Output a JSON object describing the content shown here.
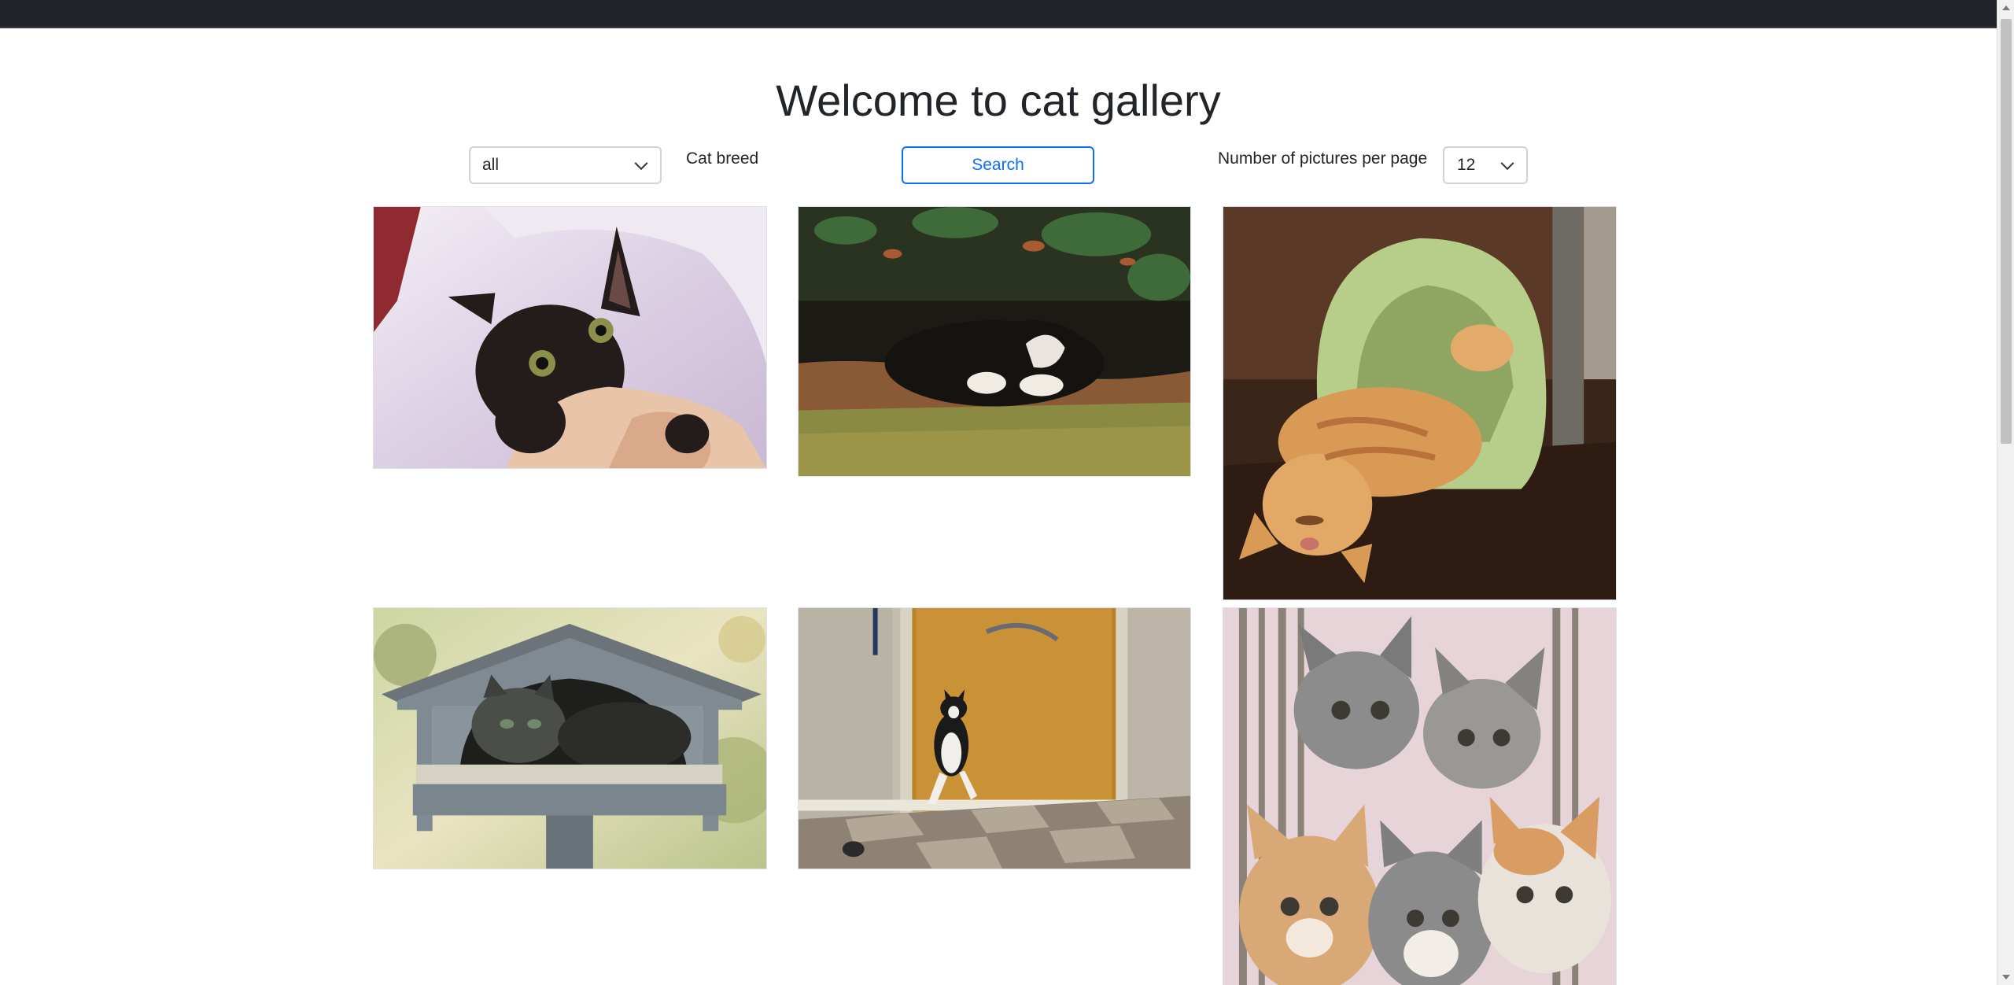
{
  "header": {
    "title": "Welcome to cat gallery"
  },
  "filters": {
    "breed_select_value": "all",
    "breed_label": "Cat breed",
    "search_label": "Search",
    "per_page_label": "Number of pictures per page",
    "per_page_value": "12"
  },
  "gallery": {
    "images": [
      {
        "subject": "black kitten biting a hand"
      },
      {
        "subject": "black and white cat lying in grass"
      },
      {
        "subject": "orange cat sleeping upside down by green cat bed"
      },
      {
        "subject": "tabby cat inside a bird feeder house"
      },
      {
        "subject": "black and white cat jumping by a door"
      },
      {
        "subject": "five kittens looking up"
      }
    ]
  },
  "colors": {
    "topbar": "#212529",
    "accent": "#0d6efd",
    "text": "#212529",
    "border": "#ced4da"
  }
}
